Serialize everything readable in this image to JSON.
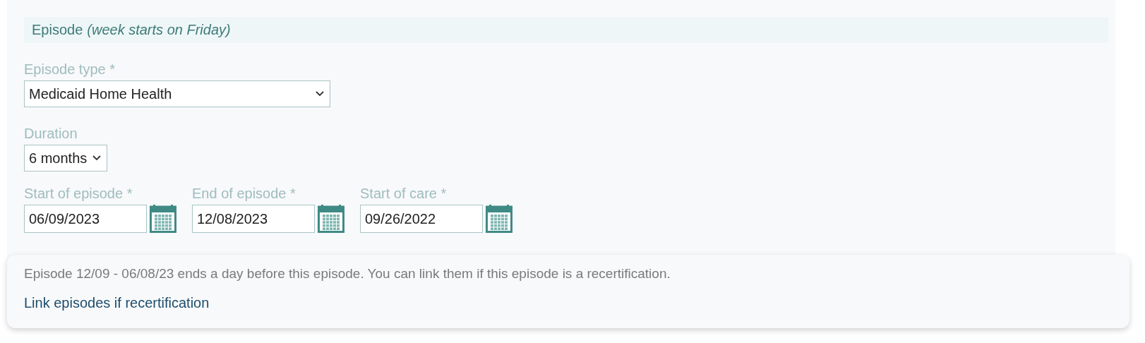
{
  "section": {
    "title": "Episode",
    "note": "(week starts on Friday)"
  },
  "episode_type": {
    "label": "Episode type *",
    "value": "Medicaid Home Health"
  },
  "duration": {
    "label": "Duration",
    "value": "6 months"
  },
  "dates": [
    {
      "label": "Start of episode *",
      "value": "06/09/2023"
    },
    {
      "label": "End of episode *",
      "value": "12/08/2023"
    },
    {
      "label": "Start of care *",
      "value": "09/26/2022"
    }
  ],
  "notice": {
    "message": "Episode 12/09 - 06/08/23 ends a day before this episode. You can link them if this episode is a recertification.",
    "link": "Link episodes if recertification"
  }
}
